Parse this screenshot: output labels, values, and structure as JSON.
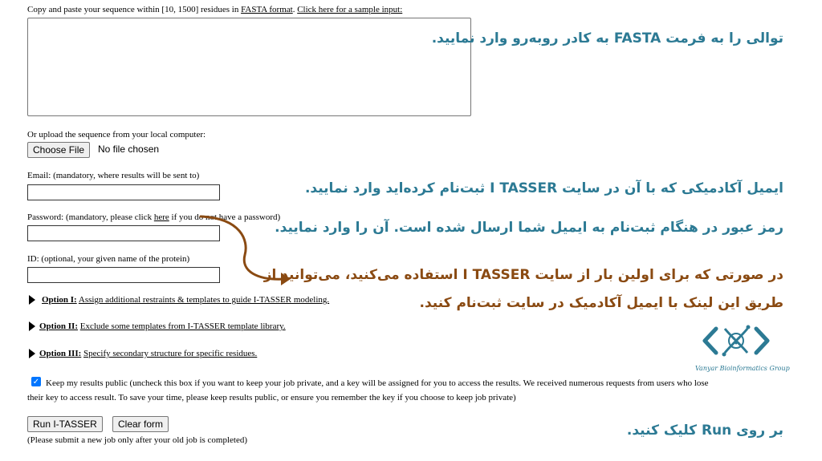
{
  "sequence": {
    "intro": "Copy and paste your sequence within [10, 1500] residues in ",
    "fasta_link": "FASTA format",
    "sample_link": "Click here for a sample input:",
    "value": ""
  },
  "upload": {
    "label": "Or upload the sequence from your local computer:",
    "button": "Choose File",
    "status": "No file chosen"
  },
  "email": {
    "label": "Email: (mandatory, where results will be sent to)",
    "value": ""
  },
  "password": {
    "label_pre": "Password: (mandatory, please click ",
    "link": "here",
    "label_post": " if you do not have a password)",
    "value": ""
  },
  "id_field": {
    "label": "ID: (optional, your given name of the protein)",
    "value": ""
  },
  "options": [
    {
      "title": "Option I:",
      "desc": "Assign additional restraints & templates to guide I-TASSER modeling."
    },
    {
      "title": "Option II:",
      "desc": "Exclude some templates from I-TASSER template library."
    },
    {
      "title": "Option III:",
      "desc": "Specify secondary structure for specific residues."
    }
  ],
  "keep_public": {
    "checked": true,
    "text_line1": "Keep my results public (uncheck this box if you want to keep your job private, and a key will be assigned for you to access the results. We received numerous requests from users who lose",
    "text_line2": "their key to access result. To save your time, please keep results public, or ensure you remember the key if you choose to keep job private)"
  },
  "buttons": {
    "run": "Run I-TASSER",
    "clear": "Clear form"
  },
  "note": "(Please submit a new job only after your old job is completed)",
  "annotations": {
    "fasta": "توالی را به فرمت FASTA به کادر روبه‌رو وارد نمایید.",
    "email": "ایمیل آکادمیکی که با آن در سایت I TASSER ثبت‌نام کرده‌اید وارد نمایید.",
    "password": "رمز عبور در هنگام ثبت‌نام به ایمیل شما ارسال شده است. آن را وارد نمایید.",
    "register_line1": "در صورتی که برای اولین بار از سایت I TASSER استفاده می‌کنید، می‌توانید از",
    "register_line2": "طریق این لینک با ایمیل آکادمیک در سایت ثبت‌نام کنید.",
    "run": "بر روی Run کلیک کنید."
  },
  "logo": {
    "text": "Vanyar Bioinformatics Group"
  },
  "colors": {
    "annotation_teal": "#2c7a94",
    "annotation_brown": "#8a4a12",
    "checkbox": "#0075ff"
  }
}
